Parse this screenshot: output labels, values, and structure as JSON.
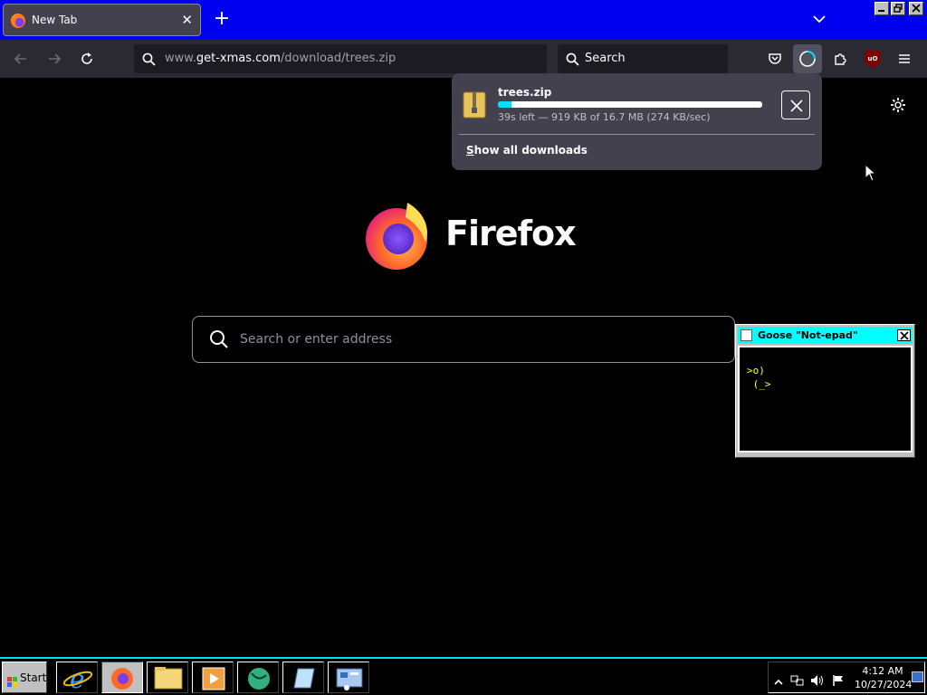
{
  "browser": {
    "tab": {
      "title": "New Tab",
      "close_label": "✕"
    },
    "new_tab_label": "+",
    "url": {
      "prefix": "www.",
      "domain": "get-xmas.com",
      "path": "/download/trees.zip"
    },
    "search_bar": {
      "label": "Search"
    },
    "ublock_label": "uO"
  },
  "downloads_panel": {
    "file_name": "trees.zip",
    "progress_fraction": 0.05,
    "status": "39s left — 919 KB of 16.7 MB (274 KB/sec)",
    "show_all": "Show all downloads",
    "show_all_accesskey": "S",
    "show_all_rest": "how all downloads"
  },
  "new_tab_page": {
    "brand": "Firefox",
    "search_placeholder": "Search or enter address"
  },
  "notepad": {
    "title": "Goose \"Not-epad\"",
    "content": ">o)\n (_>"
  },
  "taskbar": {
    "start_label": "Start",
    "clock_time": "4:12 AM",
    "clock_date": "10/27/2024",
    "apps": [
      "internet-explorer",
      "firefox",
      "file-explorer",
      "media-player",
      "globe-app",
      "notepad-app",
      "control-panel"
    ]
  },
  "colors": {
    "tabstrip": "#0000f0",
    "toolbar": "#2b2a33",
    "accent": "#00ddff",
    "notepad_title": "#00ffff",
    "notepad_text": "#ffff33"
  }
}
